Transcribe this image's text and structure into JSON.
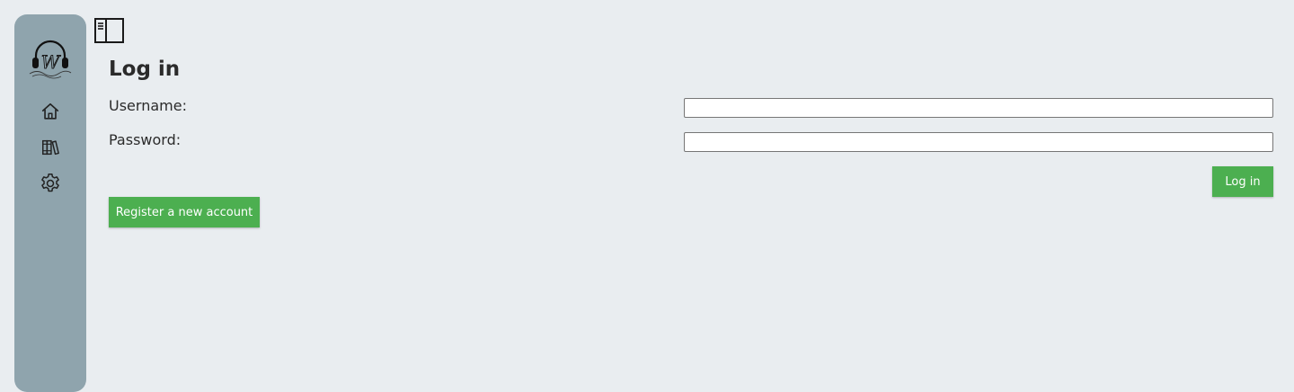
{
  "sidebar": {
    "logo_icon": "headphones-logo-icon",
    "logo_letter": "W",
    "items": [
      {
        "name": "home",
        "icon": "home-icon"
      },
      {
        "name": "library",
        "icon": "books-icon"
      },
      {
        "name": "settings",
        "icon": "gear-icon"
      }
    ]
  },
  "toolbar": {
    "toggle_icon": "sidebar-toggle-icon"
  },
  "login": {
    "title": "Log in",
    "username_label": "Username:",
    "username_value": "",
    "password_label": "Password:",
    "password_value": "",
    "submit_label": "Log in",
    "register_label": "Register a new account"
  },
  "colors": {
    "background": "#e9edf0",
    "sidebar": "#8fa4ad",
    "button": "#4caf50"
  }
}
